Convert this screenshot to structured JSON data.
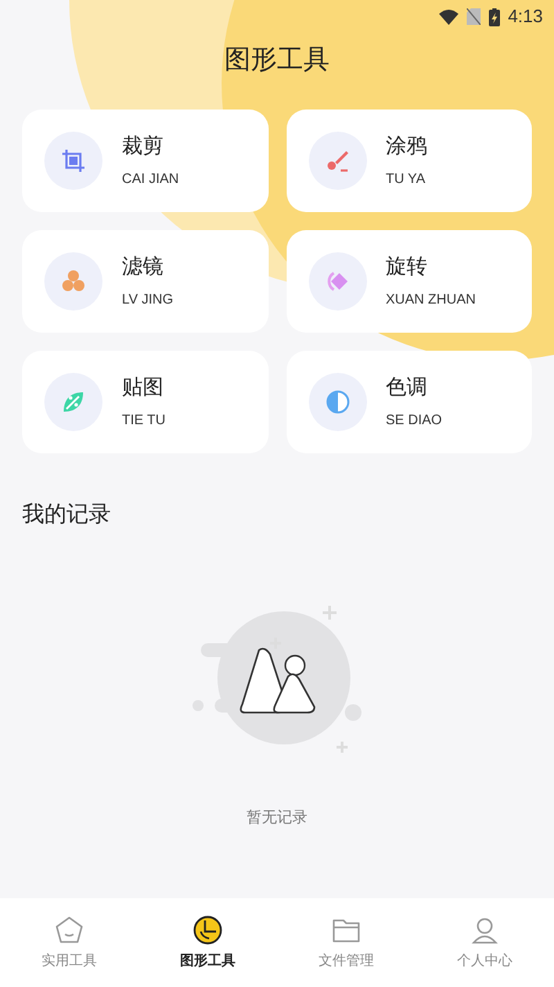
{
  "status_bar": {
    "time": "4:13"
  },
  "title": "图形工具",
  "tools": [
    {
      "kind": "crop",
      "name": "裁剪",
      "pinyin": "CAI JIAN"
    },
    {
      "kind": "brush",
      "name": "涂鸦",
      "pinyin": "TU YA"
    },
    {
      "kind": "filter",
      "name": "滤镜",
      "pinyin": "LV JING"
    },
    {
      "kind": "rotate",
      "name": "旋转",
      "pinyin": "XUAN ZHUAN"
    },
    {
      "kind": "sticker",
      "name": "贴图",
      "pinyin": "TIE TU"
    },
    {
      "kind": "tone",
      "name": "色调",
      "pinyin": "SE DIAO"
    }
  ],
  "records": {
    "heading": "我的记录",
    "empty_text": "暂无记录"
  },
  "tab_bar": [
    {
      "kind": "home",
      "label": "实用工具",
      "selected": false
    },
    {
      "kind": "chart",
      "label": "图形工具",
      "selected": true
    },
    {
      "kind": "folder",
      "label": "文件管理",
      "selected": false
    },
    {
      "kind": "user",
      "label": "个人中心",
      "selected": false
    }
  ]
}
